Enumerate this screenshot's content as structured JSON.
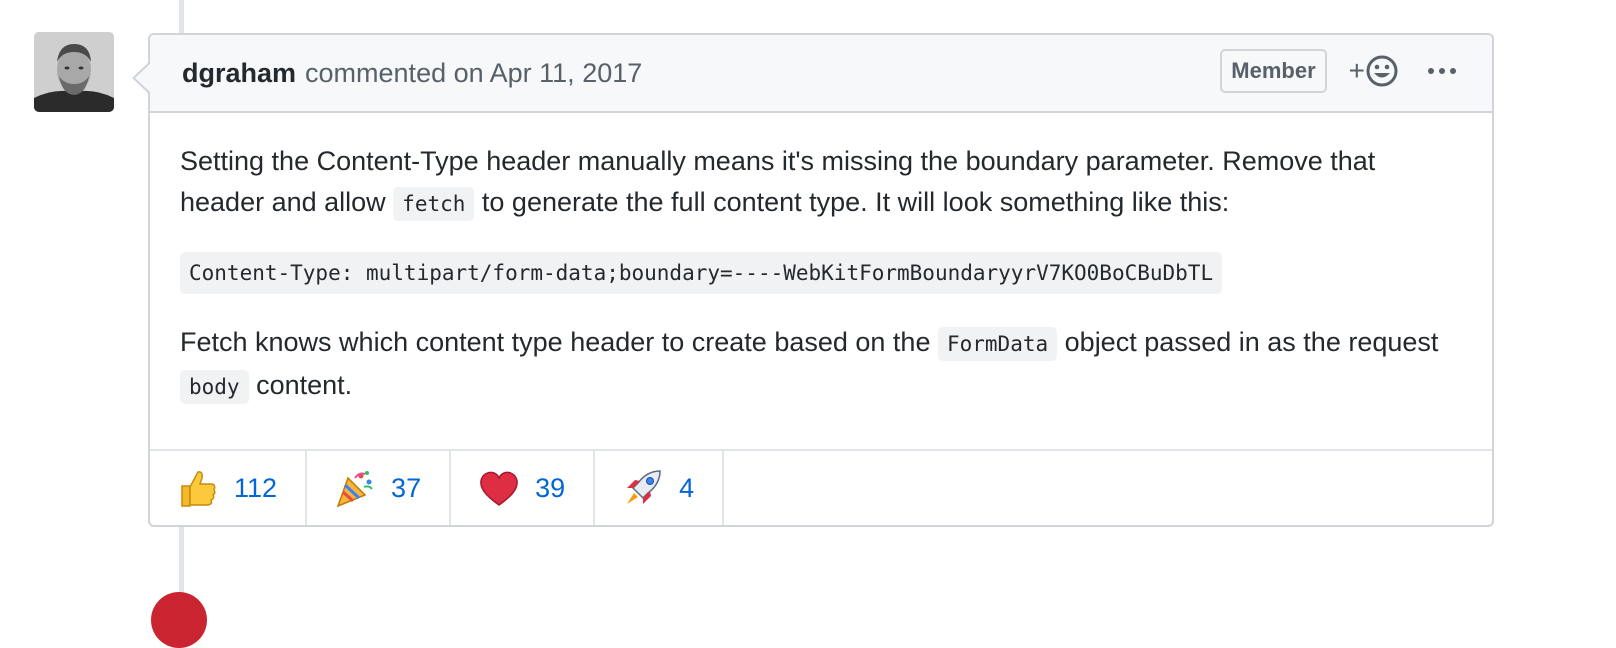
{
  "comment": {
    "author": "dgraham",
    "action": "commented on Apr 11, 2017",
    "role": "Member",
    "add_reaction_plus": "+",
    "body": {
      "p1_text1": "Setting the Content-Type header manually means it's missing the boundary parameter. Remove that header and allow",
      "p1_code": "fetch",
      "p1_text2": "to generate the full content type. It will look something like this:",
      "code_block": "Content-Type: multipart/form-data;boundary=----WebKitFormBoundaryyrV7KO0BoCBuDbTL",
      "p2_text1": "Fetch knows which content type header to create based on the",
      "p2_code1": "FormData",
      "p2_text2": "object passed in as the request",
      "p2_code2": "body",
      "p2_text3": "content."
    },
    "reactions": [
      {
        "icon": "thumbs-up-icon",
        "count": "112"
      },
      {
        "icon": "party-popper-icon",
        "count": "37"
      },
      {
        "icon": "heart-icon",
        "count": "39"
      },
      {
        "icon": "rocket-icon",
        "count": "4"
      }
    ]
  },
  "colors": {
    "link": "#0366d6",
    "border": "#d1d5da",
    "header_bg": "#f6f8fa",
    "badge_red": "#cb2431"
  }
}
